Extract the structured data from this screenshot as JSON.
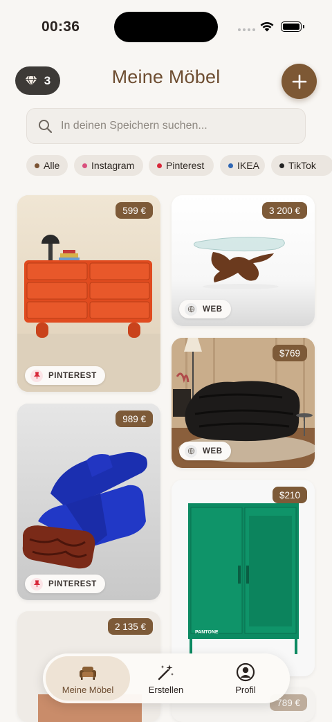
{
  "status_bar": {
    "time": "00:36"
  },
  "header": {
    "title": "Meine Möbel",
    "gem_count": "3"
  },
  "search": {
    "placeholder": "In deinen Speichern suchen..."
  },
  "filters": [
    {
      "label": "Alle",
      "color": "#7a5232"
    },
    {
      "label": "Instagram",
      "color": "#d94f7d"
    },
    {
      "label": "Pinterest",
      "color": "#d8283a"
    },
    {
      "label": "IKEA",
      "color": "#2f66b3"
    },
    {
      "label": "TikTok",
      "color": "#222222"
    }
  ],
  "cards": [
    {
      "price": "599 €",
      "source": "PINTEREST",
      "item": "orange dresser"
    },
    {
      "price": "3 200 €",
      "source": "WEB",
      "item": "glass coffee table"
    },
    {
      "price": "$769",
      "source": "WEB",
      "item": "black lounge sofa"
    },
    {
      "price": "989 €",
      "source": "PINTEREST",
      "item": "blue velvet sofa"
    },
    {
      "price": "$210",
      "source": "",
      "item": "green metal locker",
      "brand": "PANTONE"
    },
    {
      "price": "2 135 €",
      "source": "",
      "item": "partially hidden item"
    },
    {
      "price": "789 €",
      "source": "",
      "item": "partially hidden item"
    }
  ],
  "nav": [
    {
      "label": "Meine Möbel",
      "icon": "sofa-icon",
      "active": true
    },
    {
      "label": "Erstellen",
      "icon": "magic-wand-icon",
      "active": false
    },
    {
      "label": "Profil",
      "icon": "profile-icon",
      "active": false
    }
  ],
  "colors": {
    "accent": "#7d5834",
    "title": "#6e4e32",
    "background": "#f8f6f3"
  }
}
